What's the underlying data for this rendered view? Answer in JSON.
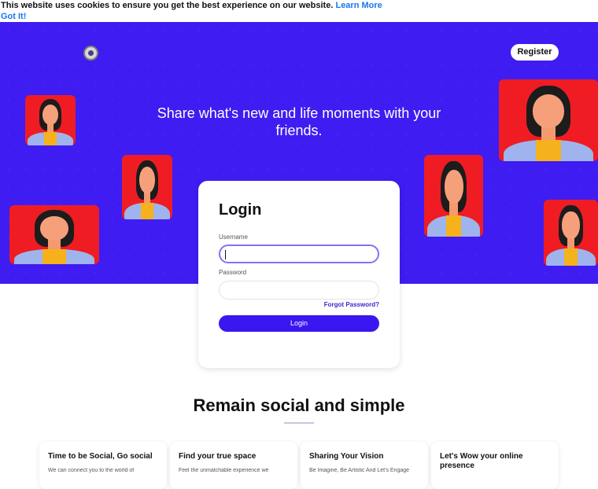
{
  "cookie_banner": {
    "message": "This website uses cookies to ensure you get the best experience on our website.",
    "learn_more": "Learn More",
    "got_it": "Got It!"
  },
  "header": {
    "logo_icon": "site-logo",
    "register_label": "Register"
  },
  "hero": {
    "tagline": "Share what's new and life moments with your friends.",
    "background_color": "#3f1cf1"
  },
  "login": {
    "title": "Login",
    "username_label": "Username",
    "password_label": "Password",
    "forgot_password": "Forgot Password?",
    "button_label": "Login"
  },
  "features": {
    "title": "Remain social and simple",
    "items": [
      {
        "title": "Time to be Social, Go social",
        "desc": "We can connect you to the world of"
      },
      {
        "title": "Find your true space",
        "desc": "Feel the unmatchable experience we"
      },
      {
        "title": "Sharing Your Vision",
        "desc": "Be Imagine, Be Artistic And Let's Engage"
      },
      {
        "title": "Let's Wow your online presence",
        "desc": ""
      }
    ]
  }
}
